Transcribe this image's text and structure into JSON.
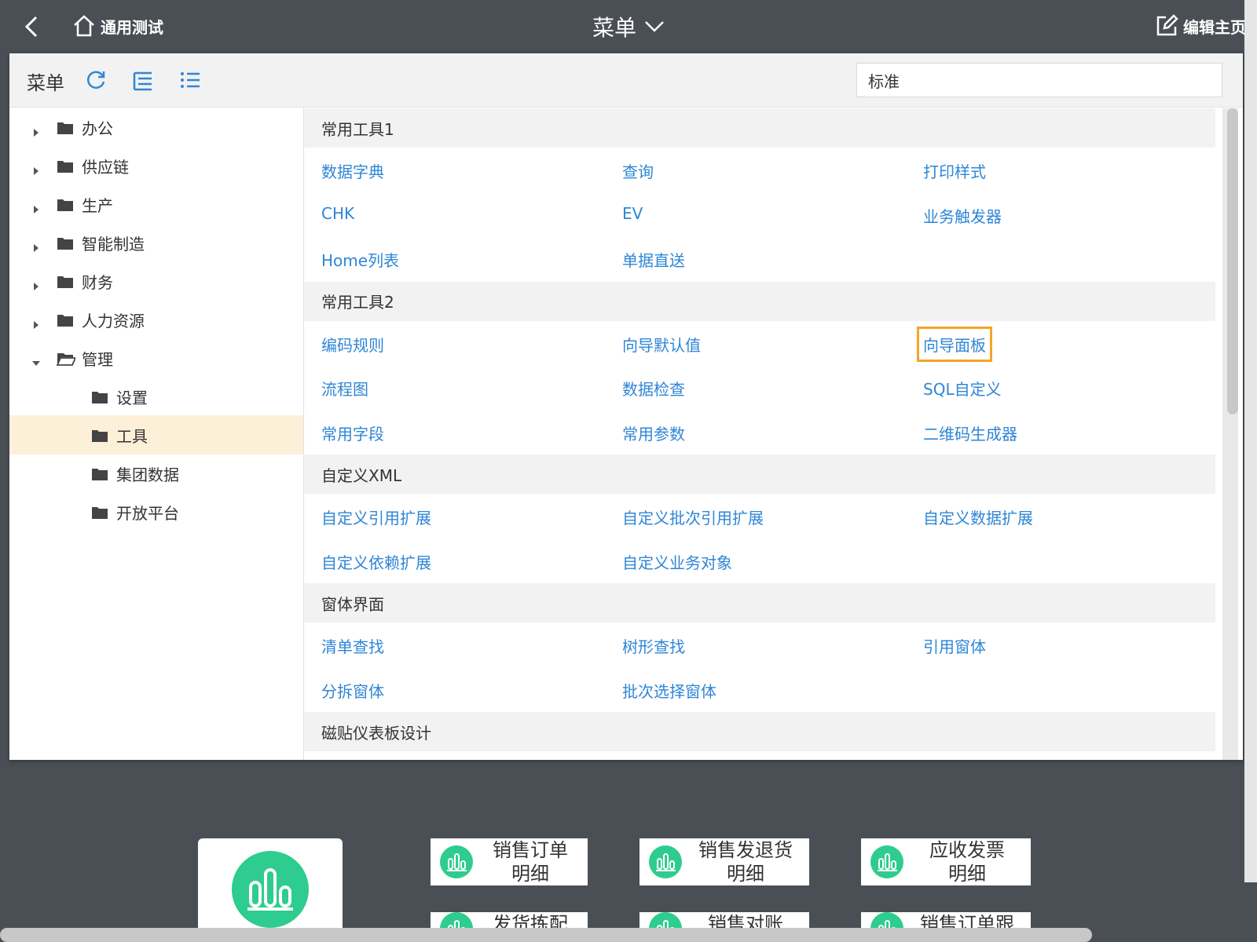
{
  "header": {
    "home_label": "通用测试",
    "title": "菜单",
    "edit_label": "编辑主页"
  },
  "toolbar": {
    "title": "菜单",
    "search_value": "标准"
  },
  "tree": [
    {
      "label": "办公",
      "level": 0,
      "state": "collapsed"
    },
    {
      "label": "供应链",
      "level": 0,
      "state": "collapsed"
    },
    {
      "label": "生产",
      "level": 0,
      "state": "collapsed"
    },
    {
      "label": "智能制造",
      "level": 0,
      "state": "collapsed"
    },
    {
      "label": "财务",
      "level": 0,
      "state": "collapsed"
    },
    {
      "label": "人力资源",
      "level": 0,
      "state": "collapsed"
    },
    {
      "label": "管理",
      "level": 0,
      "state": "expanded"
    },
    {
      "label": "设置",
      "level": 1
    },
    {
      "label": "工具",
      "level": 1,
      "selected": true
    },
    {
      "label": "集团数据",
      "level": 1
    },
    {
      "label": "开放平台",
      "level": 1
    }
  ],
  "sections": [
    {
      "title": "常用工具1",
      "items": [
        "数据字典",
        "查询",
        "打印样式",
        "CHK",
        "EV",
        "业务触发器",
        "Home列表",
        "单据直送"
      ]
    },
    {
      "title": "常用工具2",
      "items": [
        "编码规则",
        "向导默认值",
        "向导面板",
        "流程图",
        "数据检查",
        "SQL自定义",
        "常用字段",
        "常用参数",
        "二维码生成器"
      ],
      "highlighted": "向导面板"
    },
    {
      "title": "自定义XML",
      "items": [
        "自定义引用扩展",
        "自定义批次引用扩展",
        "自定义数据扩展",
        "自定义依赖扩展",
        "自定义业务对象"
      ]
    },
    {
      "title": "窗体界面",
      "items": [
        "清单查找",
        "树形查找",
        "引用窗体",
        "分拆窗体",
        "批次选择窗体"
      ]
    },
    {
      "title": "磁贴仪表板设计",
      "items": []
    }
  ],
  "dashboard": {
    "tiles": [
      {
        "line1": "销售订单",
        "line2": "明细"
      },
      {
        "line1": "销售发退货",
        "line2": "明细"
      },
      {
        "line1": "应收发票",
        "line2": "明细"
      },
      {
        "line1": "发货拣配",
        "line2": ""
      },
      {
        "line1": "销售对账",
        "line2": ""
      },
      {
        "line1": "销售订单跟",
        "line2": ""
      }
    ]
  },
  "colors": {
    "topbar": "#4a4f55",
    "link": "#2f86d6",
    "highlight_border": "#f5a623",
    "selected_row": "#fdf0d8",
    "tile_icon": "#2ecc8e"
  },
  "icons": [
    "back-icon",
    "home-icon",
    "chevron-down-icon",
    "edit-icon",
    "refresh-icon",
    "indent-list-icon",
    "bullet-list-icon",
    "folder-icon",
    "folder-open-icon",
    "caret-right-icon",
    "caret-down-icon",
    "bar-chart-icon"
  ]
}
